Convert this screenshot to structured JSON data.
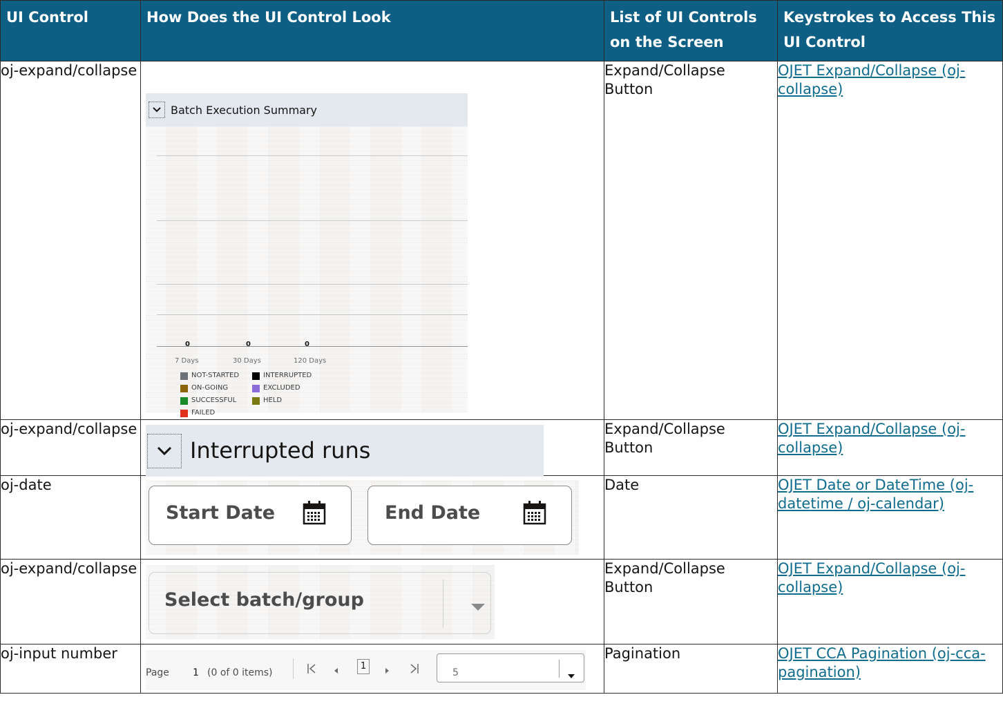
{
  "table": {
    "headers": [
      "UI Control",
      "How Does the UI Control Look",
      "List of UI Controls on the Screen",
      "Keystrokes to Access This UI Control"
    ],
    "rows": [
      {
        "control": "oj-expand/collapse",
        "controls_list": "Expand/Collapse Button",
        "keystrokes_link": "OJET Expand/Collapse (oj-collapse)"
      },
      {
        "control": "oj-expand/collapse",
        "controls_list": "Expand/Collapse Button",
        "keystrokes_link": "OJET Expand/Collapse (oj-collapse)"
      },
      {
        "control": "oj-date",
        "controls_list": "Date",
        "keystrokes_link": "OJET Date or DateTime (oj-datetime / oj-calendar)"
      },
      {
        "control": "oj-expand/collapse",
        "controls_list": "Expand/Collapse Button",
        "keystrokes_link": "OJET Expand/Collapse (oj-collapse)"
      },
      {
        "control": "oj-input number",
        "controls_list": "Pagination",
        "keystrokes_link": "OJET CCA Pagination (oj-cca-pagination)"
      }
    ]
  },
  "shot_batch": {
    "title": "Batch Execution Summary",
    "values": [
      "0",
      "0",
      "0"
    ],
    "periods": [
      "7 Days",
      "30 Days",
      "120 Days"
    ],
    "legend": [
      {
        "label": "NOT-STARTED",
        "color": "#6d7178"
      },
      {
        "label": "INTERRUPTED",
        "color": "#000000"
      },
      {
        "label": "ON-GOING",
        "color": "#8c6508"
      },
      {
        "label": "EXCLUDED",
        "color": "#8b6bd8"
      },
      {
        "label": "SUCCESSFUL",
        "color": "#1a8a2a"
      },
      {
        "label": "HELD",
        "color": "#7a7a12"
      },
      {
        "label": "FAILED",
        "color": "#e0301e"
      }
    ]
  },
  "shot_interrupted": {
    "title": "Interrupted runs"
  },
  "shot_date": {
    "start_label": "Start Date",
    "end_label": "End Date"
  },
  "shot_select": {
    "placeholder": "Select batch/group"
  },
  "shot_pagination": {
    "page_label": "Page",
    "page_value": "1",
    "items_text": "(0 of 0 items)",
    "current_page": "1",
    "page_size": "5"
  },
  "colors": {
    "header_bg": "#0f5f84",
    "link": "#0f6c8e",
    "panel_header": "#e3e9ef"
  }
}
